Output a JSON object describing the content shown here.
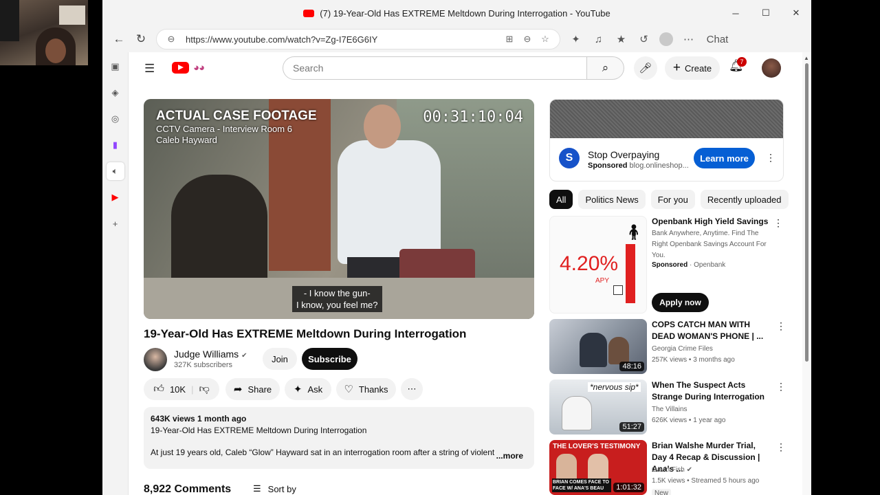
{
  "browser": {
    "window_title": "(7) 19-Year-Old Has EXTREME Meltdown During Interrogation - YouTube",
    "url": "https://www.youtube.com/watch?v=Zg-I7E6G6IY",
    "chat_label": "Chat"
  },
  "youtube": {
    "search_placeholder": "Search",
    "create_label": "Create",
    "notifications_count": "7"
  },
  "video": {
    "overlay_title": "ACTUAL CASE FOOTAGE",
    "overlay_line1": "CCTV Camera - Interview Room 6",
    "overlay_line2": "Caleb Hayward",
    "timestamp": "00:31:10:04",
    "caption_line1": "- I know the gun-",
    "caption_line2": "I know, you feel me?",
    "title": "19-Year-Old Has EXTREME Meltdown During Interrogation",
    "channel_name": "Judge Williams",
    "subscribers": "327K subscribers",
    "join_label": "Join",
    "subscribe_label": "Subscribe",
    "likes": "10K",
    "share_label": "Share",
    "ask_label": "Ask",
    "thanks_label": "Thanks",
    "views_date": "643K views  1 month ago",
    "desc_title": "19-Year-Old Has EXTREME Meltdown During Interrogation",
    "desc_body": "At just 19 years old, Caleb “Glow” Hayward sat in an interrogation room after a string of violent",
    "more_label": "...more",
    "comments_count": "8,922 Comments",
    "sort_label": "Sort by"
  },
  "ad": {
    "title": "Stop Overpaying",
    "sponsored": "Sponsored",
    "domain": "blog.onlineshop...",
    "cta": "Learn more"
  },
  "chips": [
    "All",
    "Politics News",
    "For you",
    "Recently uploaded"
  ],
  "recommendations": [
    {
      "title": "Openbank High Yield Savings",
      "desc": "Bank Anywhere, Anytime. Find The Right Openbank Savings Account For You.",
      "sponsored": "Sponsored",
      "advertiser": "Openbank",
      "thumb_text": "4.20%",
      "thumb_sub": "APY",
      "cta": "Apply now"
    },
    {
      "title": "COPS CATCH MAN WITH DEAD WOMAN'S PHONE | ...",
      "channel": "Georgia Crime Files",
      "stats": "257K views • 3 months ago",
      "duration": "48:16"
    },
    {
      "title": "When The Suspect Acts Strange During Interrogation",
      "channel": "The Villains",
      "stats": "626K views • 1 year ago",
      "duration": "51:27",
      "thumb_text": "*nervous sip*"
    },
    {
      "title": "Brian Walshe Murder Trial, Day 4 Recap & Discussion | Ana's ...",
      "channel": "Gavin Fish",
      "stats": "1.5K views • Streamed 5 hours ago",
      "duration": "1:01:32",
      "badge": "New",
      "thumb_text": "THE LOVER'S TESTIMONY",
      "thumb_sub": "BRIAN COMES FACE TO FACE W/ ANA'S BEAU"
    }
  ]
}
